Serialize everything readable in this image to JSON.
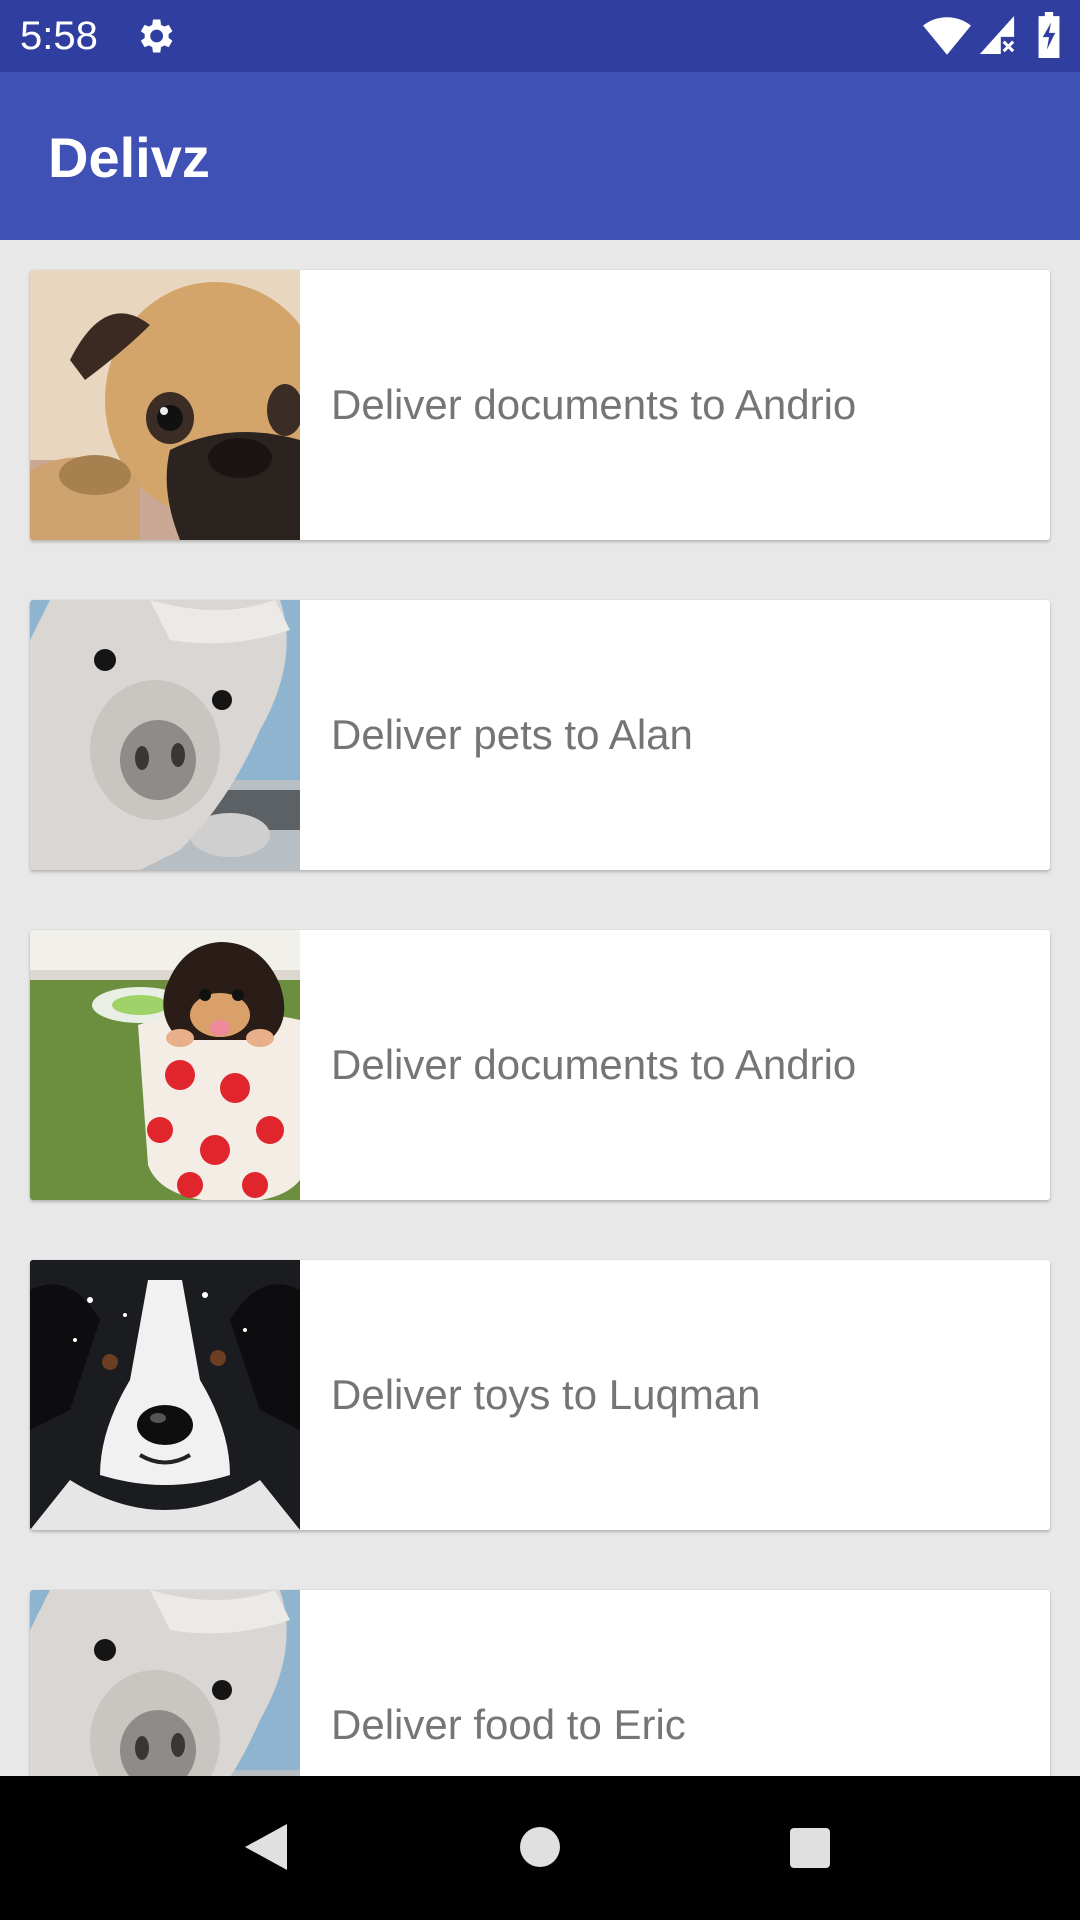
{
  "status_bar": {
    "time": "5:58",
    "icons": [
      "gear-icon",
      "wifi-icon",
      "signal-icon",
      "battery-charging-icon"
    ]
  },
  "app_bar": {
    "title": "Delivz"
  },
  "deliveries": [
    {
      "label": "Deliver documents to Andrio",
      "image": "pug-photo"
    },
    {
      "label": "Deliver pets to Alan",
      "image": "alpaca-photo"
    },
    {
      "label": "Deliver documents to Andrio",
      "image": "puppy-in-cup-photo"
    },
    {
      "label": "Deliver toys to Luqman",
      "image": "border-collie-photo"
    },
    {
      "label": "Deliver food to Eric",
      "image": "alpaca-photo"
    }
  ],
  "nav_bar": {
    "icons": [
      "back-icon",
      "home-icon",
      "recent-apps-icon"
    ]
  },
  "colors": {
    "status_bar": "#303f9f",
    "app_bar": "#3f51b5",
    "background": "#e8e8e8",
    "card_text": "#757575"
  }
}
